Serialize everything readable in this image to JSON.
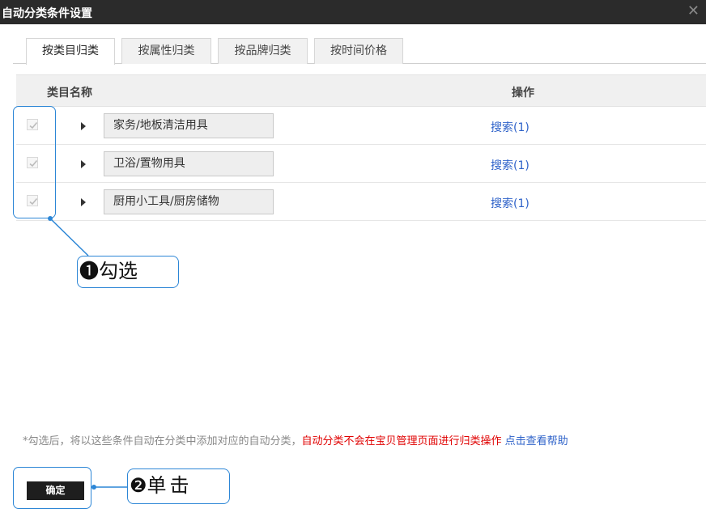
{
  "dialog": {
    "title": "自动分类条件设置",
    "close_symbol": "✕"
  },
  "tabs": [
    {
      "label": "按类目归类",
      "active": true
    },
    {
      "label": "按属性归类",
      "active": false
    },
    {
      "label": "按品牌归类",
      "active": false
    },
    {
      "label": "按时间价格",
      "active": false
    }
  ],
  "table": {
    "headers": {
      "category_name": "类目名称",
      "action": "操作"
    },
    "rows": [
      {
        "checked": true,
        "category": "家务/地板清洁用具",
        "action": "搜索(1)"
      },
      {
        "checked": true,
        "category": "卫浴/置物用具",
        "action": "搜索(1)"
      },
      {
        "checked": true,
        "category": "厨用小工具/厨房储物",
        "action": "搜索(1)"
      }
    ]
  },
  "note": {
    "gray": "*勾选后，将以这些条件自动在分类中添加对应的自动分类，",
    "red": "自动分类不会在宝贝管理页面进行归类操作",
    "link": "点击查看帮助"
  },
  "confirm_button": "确定",
  "annotations": [
    {
      "number": "❶",
      "text": "勾选"
    },
    {
      "number": "❷",
      "text": "单击"
    }
  ],
  "colors": {
    "accent": "#2c86d6",
    "link": "#2e62c9",
    "warning": "#e00000",
    "titlebar": "#2b2b2b"
  }
}
